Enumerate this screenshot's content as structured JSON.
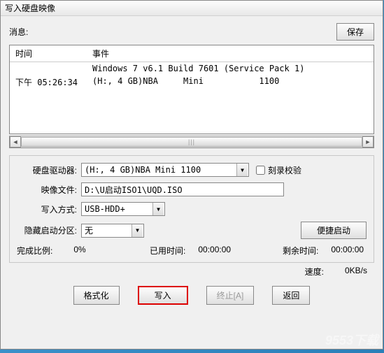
{
  "window": {
    "title": "写入硬盘映像"
  },
  "topbar": {
    "message_label": "消息:",
    "save_button": "保存"
  },
  "table": {
    "col_time": "时间",
    "col_event": "事件",
    "rows": [
      {
        "time": "",
        "event": "Windows 7 v6.1 Build 7601 (Service Pack 1)"
      },
      {
        "time": "下午 05:26:34",
        "event": "(H:, 4 GB)NBA     Mini           1100"
      }
    ]
  },
  "scroll_thumb": "|||",
  "form": {
    "drive_label": "硬盘驱动器:",
    "drive_value": "(H:, 4 GB)NBA     Mini        1100",
    "verify_label": "刻录校验",
    "image_label": "映像文件:",
    "image_value": "D:\\U启动ISO1\\UQD.ISO",
    "method_label": "写入方式:",
    "method_value": "USB-HDD+",
    "hide_label": "隐藏启动分区:",
    "hide_value": "无",
    "convenient_boot": "便捷启动"
  },
  "status": {
    "progress_label": "完成比例:",
    "progress_value": "0%",
    "elapsed_label": "已用时间:",
    "elapsed_value": "00:00:00",
    "remain_label": "剩余时间:",
    "remain_value": "00:00:00",
    "speed_label": "速度:",
    "speed_value": "0KB/s"
  },
  "buttons": {
    "format": "格式化",
    "write": "写入",
    "abort": "终止[A]",
    "back": "返回"
  },
  "watermark": "9553下载"
}
